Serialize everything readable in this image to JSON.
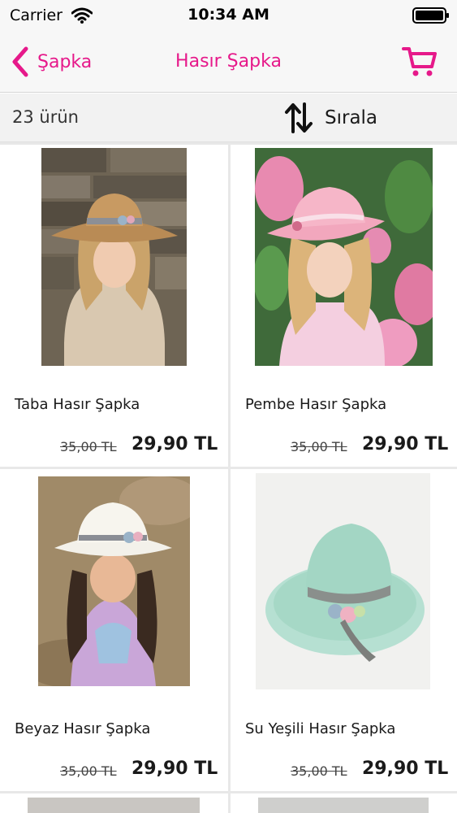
{
  "status_bar": {
    "carrier": "Carrier",
    "time": "10:34 AM"
  },
  "nav": {
    "back_label": "Şapka",
    "title": "Hasır Şapka"
  },
  "toolbar": {
    "count_label": "23 ürün",
    "sort_label": "Sırala"
  },
  "products": [
    {
      "name": "Taba Hasır Şapka",
      "old_price": "35,00 TL",
      "price": "29,90 TL"
    },
    {
      "name": "Pembe Hasır Şapka",
      "old_price": "35,00 TL",
      "price": "29,90 TL"
    },
    {
      "name": "Beyaz Hasır Şapka",
      "old_price": "35,00 TL",
      "price": "29,90 TL"
    },
    {
      "name": "Su Yeşili Hasır Şapka",
      "old_price": "35,00 TL",
      "price": "29,90 TL"
    }
  ],
  "colors": {
    "accent": "#e6198a",
    "background": "#ffffff",
    "grid_gap": "#e8e8e8"
  }
}
